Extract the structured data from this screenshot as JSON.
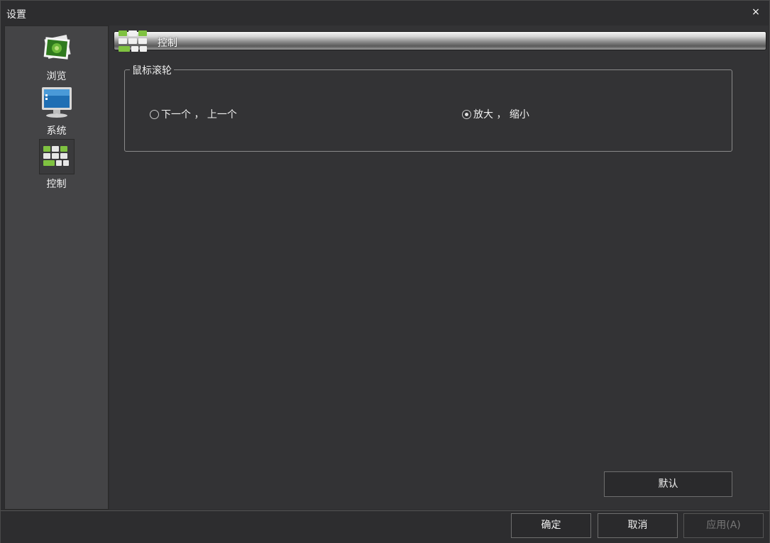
{
  "window": {
    "title": "设置",
    "close_label": "×"
  },
  "sidebar": {
    "items": [
      {
        "label": "浏览",
        "icon": "photo-stack-icon"
      },
      {
        "label": "系统",
        "icon": "monitor-icon"
      },
      {
        "label": "控制",
        "icon": "keyboard-keys-icon"
      }
    ],
    "selected": "控制"
  },
  "header": {
    "title": "控制",
    "icon": "keyboard-keys-icon"
  },
  "mouse_wheel": {
    "legend": "鼠标滚轮",
    "options": [
      {
        "label": "下一个 ， 上一个",
        "checked": false
      },
      {
        "label": "放大 ， 缩小",
        "checked": true
      }
    ]
  },
  "buttons": {
    "default": "默认",
    "ok": "确定",
    "cancel": "取消",
    "apply": "应用(A)"
  },
  "colors": {
    "accent_green": "#7fc241",
    "background": "#333335",
    "sidebar": "#444446"
  }
}
